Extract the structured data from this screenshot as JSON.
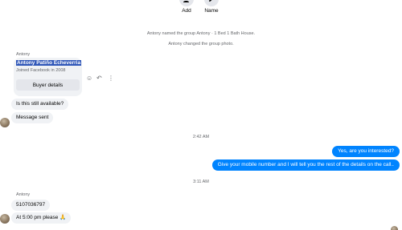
{
  "top_actions": {
    "add_label": "Add",
    "name_label": "Name"
  },
  "system_messages": [
    "Antony named the group Antony · 1 Bed 1 Bath House.",
    "Antony changed the group photo."
  ],
  "first_block": {
    "sender": "Antony",
    "card": {
      "name": "Antony Patiño Echeverria",
      "joined": "Joined Facebook in 2008",
      "button_label": "Buyer details"
    },
    "messages": [
      "Is this still available?",
      "Message sent"
    ]
  },
  "timestamp_1": "2:42 AM",
  "outgoing": [
    "Yes, are you interested?",
    "Give your mobile number and I will tell you the rest of the details on the call.."
  ],
  "timestamp_2": "3:11 AM",
  "second_block": {
    "sender": "Antony",
    "messages": [
      "5107036797",
      "At 5:00 pm please 🙏"
    ]
  },
  "icons": {
    "add": "add-person-icon",
    "name": "pencil-icon",
    "react": "smiley-icon",
    "reply": "reply-icon",
    "more": "more-dots-icon"
  },
  "colors": {
    "outgoing_bubble": "#0084ff",
    "incoming_bubble": "#f0f2f5",
    "secondary_text": "#65676b",
    "selection_highlight": "#2f56b8"
  }
}
